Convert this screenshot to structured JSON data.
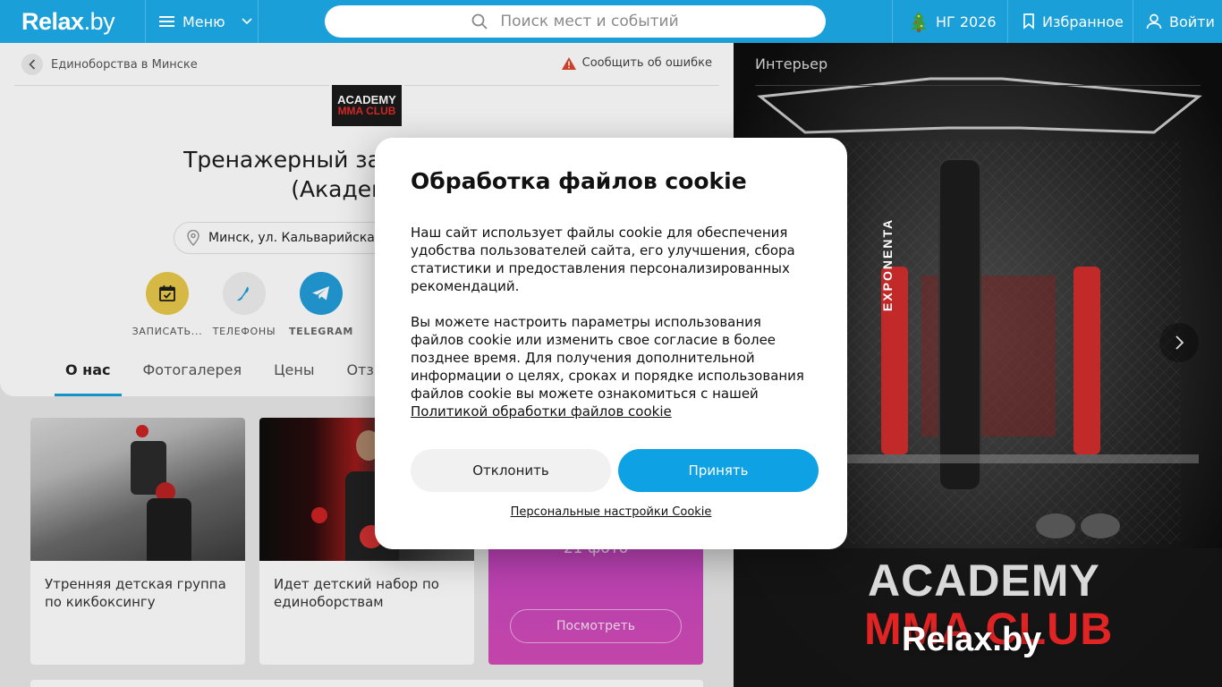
{
  "topbar": {
    "logo_main": "Relax",
    "logo_suffix": ".by",
    "menu_label": "Меню",
    "search_placeholder": "Поиск мест и событий",
    "ng_label": "НГ 2026",
    "favorites_label": "Избранное",
    "login_label": "Войти"
  },
  "colors": {
    "brand_blue": "#1a9fd8",
    "accept_blue": "#0ea2e4",
    "tab_underline": "#1a9fd8",
    "logo_red": "#e22a2a",
    "gallery_purple": "#b33fc7"
  },
  "breadcrumb": {
    "label": "Единоборства в Минске"
  },
  "report_label": "Сообщить об ошибке",
  "club_logo": {
    "line1": "ACADEMY",
    "line2": "MMA CLUB"
  },
  "place": {
    "title_line1": "Тренажерный зал и единоборс",
    "title_line2": "(Академия М",
    "address": "Минск, ул. Кальварийска"
  },
  "actions": [
    {
      "label": "ЗАПИСАТЬ...",
      "icon": "calendar-check-icon",
      "bg": "#e9c94a"
    },
    {
      "label": "ТЕЛЕФОНЫ",
      "icon": "phone-icon",
      "bg": "#efefef"
    },
    {
      "label": "TELEGRAM",
      "icon": "telegram-icon",
      "bg": "#229ed9"
    }
  ],
  "tabs": [
    {
      "label": "О нас",
      "active": true
    },
    {
      "label": "Фотогалерея"
    },
    {
      "label": "Цены"
    },
    {
      "label": "Отзывы"
    }
  ],
  "tiles": [
    {
      "caption": "Утренняя детская группа по кикбоксингу"
    },
    {
      "caption": "Идет детский набор по единоборствам"
    }
  ],
  "gallery_tile": {
    "count": "21 фото",
    "button": "Посмотреть"
  },
  "interior": {
    "title": "Интерьер",
    "banner_text": "EXPONENTA",
    "watermark_line1": "ACADEMY",
    "watermark_line2": "MMA CLUB",
    "watermark_site": "Relax.by"
  },
  "cookie": {
    "title": "Обработка файлов cookie",
    "p1": "Наш сайт использует файлы cookie для обеспечения удобства пользователей сайта, его улучшения, сбора статистики и предоставления персонализированных рекомендаций.",
    "p2": "Вы можете настроить параметры использования файлов cookie или изменить свое согласие в более позднее время. Для получения дополнительной информации о целях, сроках и порядке использования файлов cookie вы можете ознакомиться с нашей",
    "policy_link": "Политикой обработки файлов cookie",
    "decline": "Отклонить",
    "accept": "Принять",
    "personal": "Персональные настройки Cookie"
  }
}
